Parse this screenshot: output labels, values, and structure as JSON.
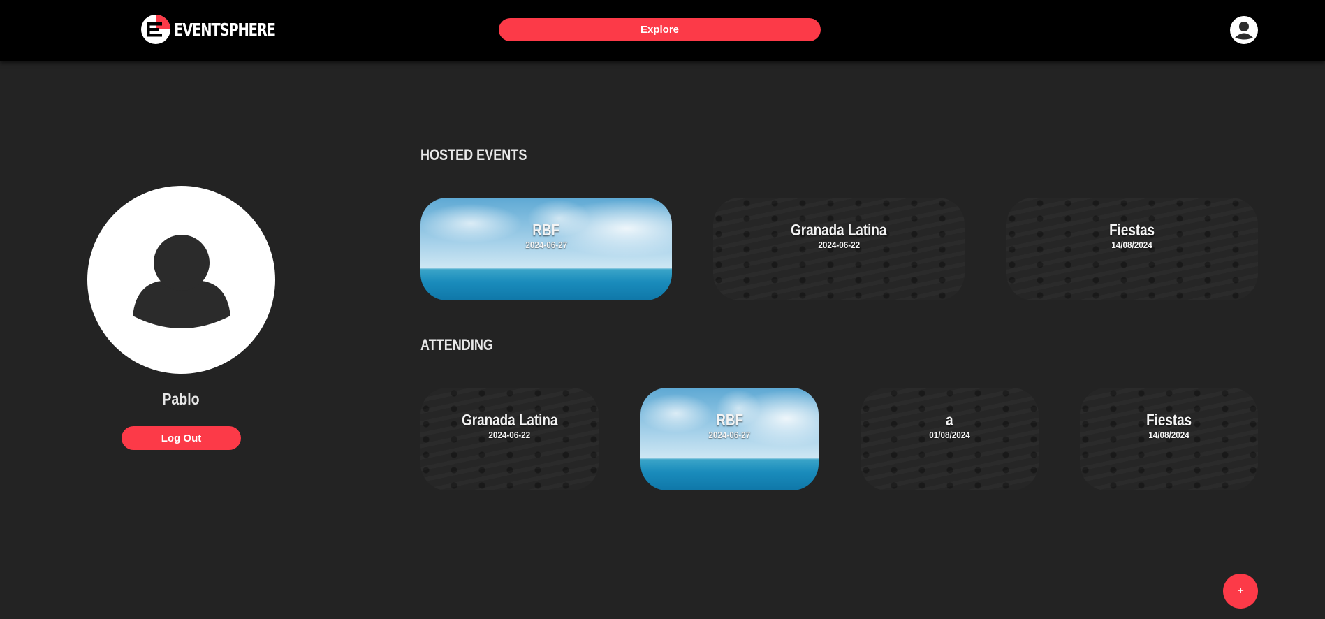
{
  "header": {
    "logo_text": "EVENTSPHERE",
    "explore_label": "Explore"
  },
  "profile": {
    "name": "Pablo",
    "logout_label": "Log Out"
  },
  "sections": {
    "hosted_title": "HOSTED EVENTS",
    "attending_title": "ATTENDING"
  },
  "hosted_events": [
    {
      "title": "RBF",
      "date": "2024-06-27",
      "image": "sea-photo"
    },
    {
      "title": "Granada Latina",
      "date": "2024-06-22",
      "image": "eventsphere-pattern"
    },
    {
      "title": "Fiestas",
      "date": "14/08/2024",
      "image": "eventsphere-pattern"
    }
  ],
  "attending_events": [
    {
      "title": "Granada Latina",
      "date": "2024-06-22",
      "image": "eventsphere-pattern"
    },
    {
      "title": "RBF",
      "date": "2024-06-27",
      "image": "sea-photo"
    },
    {
      "title": "a",
      "date": "01/08/2024",
      "image": "eventsphere-pattern"
    },
    {
      "title": "Fiestas",
      "date": "14/08/2024",
      "image": "eventsphere-pattern"
    }
  ],
  "fab_label": "+",
  "colors": {
    "accent": "#fc3a48",
    "background": "#232323",
    "header": "#000000"
  },
  "icons": {
    "logo": "eventsphere-logo-icon",
    "user": "user-icon",
    "add": "plus-icon"
  }
}
